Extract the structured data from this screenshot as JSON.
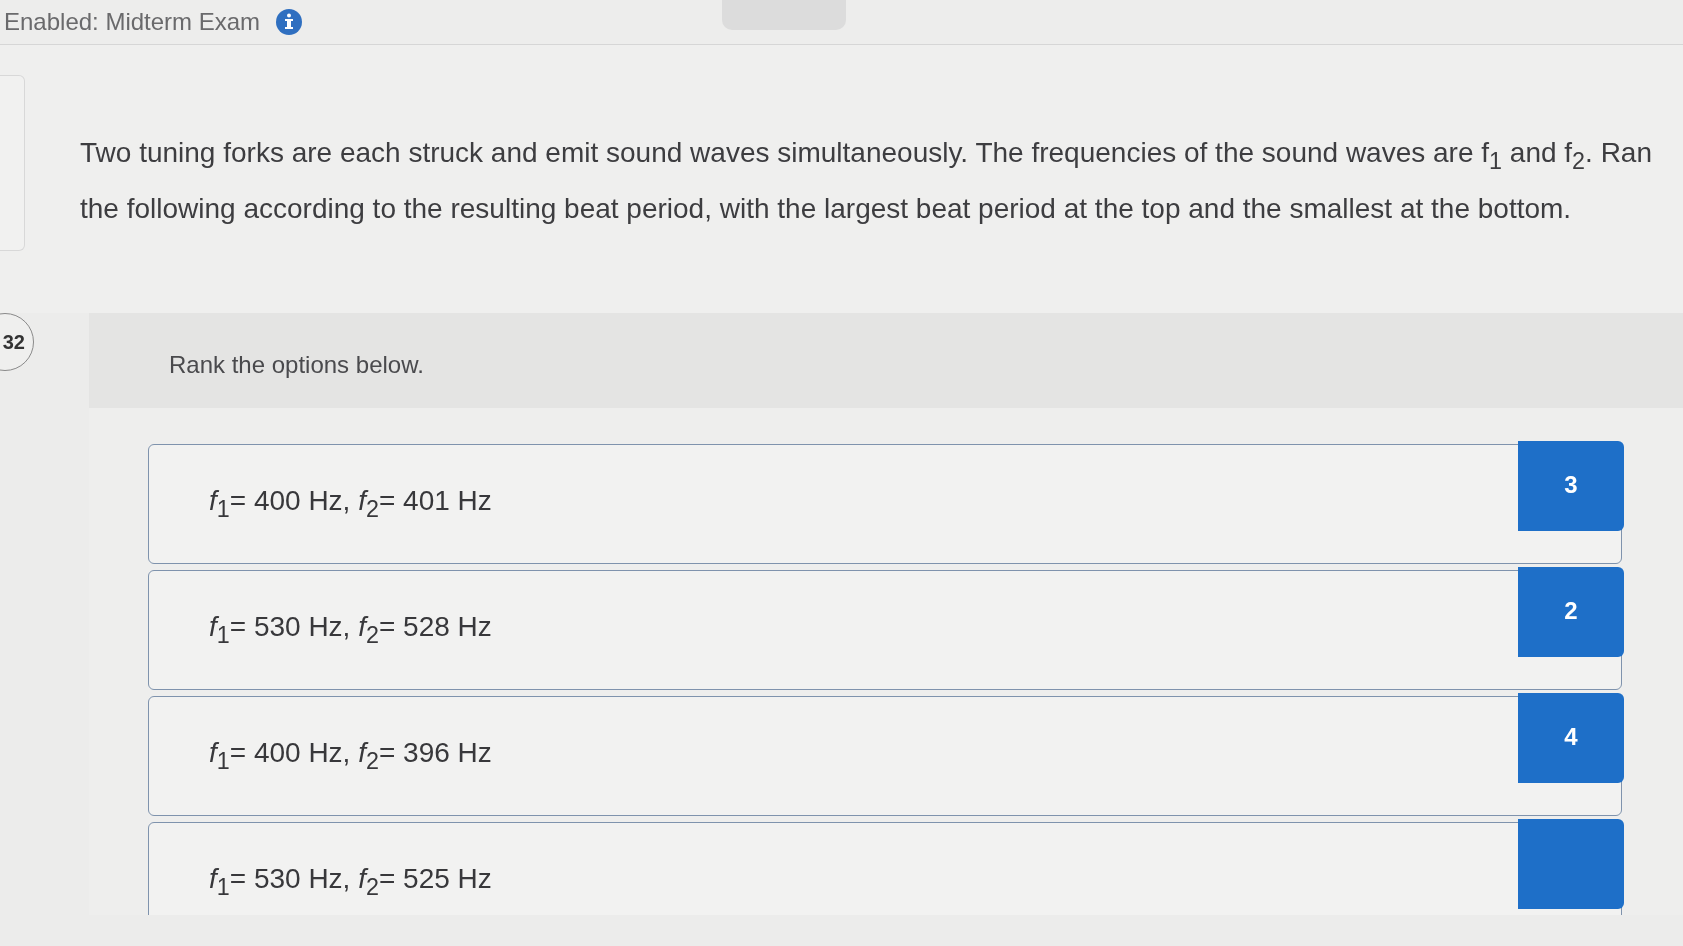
{
  "header": {
    "title": "Enabled: Midterm Exam"
  },
  "question": {
    "number": "32",
    "text": "Two tuning forks are each struck and emit sound waves simultaneously. The frequencies of the sound waves are f$_{1}$ and f$_{2}$. Ran\nthe following according to the resulting beat period, with the largest beat period at the top and the smallest at the bottom."
  },
  "ranking": {
    "instruction": "Rank the options below.",
    "options": [
      {
        "label": "*f*$_{1}$= 400 Hz, *f*$_{2}$= 401 Hz",
        "rank": "3"
      },
      {
        "label": "*f*$_{1}$= 530 Hz, *f*$_{2}$= 528 Hz",
        "rank": "2"
      },
      {
        "label": "*f*$_{1}$= 400 Hz, *f*$_{2}$= 396 Hz",
        "rank": "4"
      },
      {
        "label": "*f*$_{1}$= 530 Hz, *f*$_{2}$= 525 Hz"
      }
    ]
  }
}
